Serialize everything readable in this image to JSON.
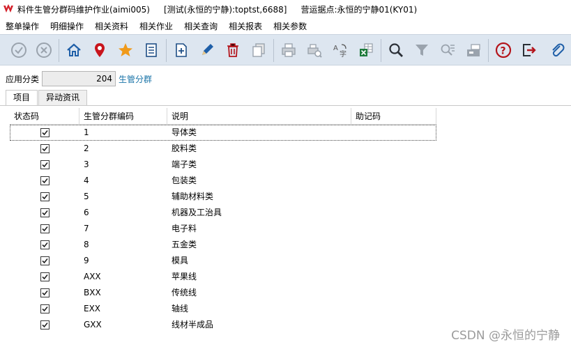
{
  "window": {
    "title": "料件生管分群码维护作业(aimi005)",
    "env": "[测试(永恒的宁静):toptst,6688]",
    "site": "营运据点:永恒的宁静01(KY01)"
  },
  "menu": [
    "整单操作",
    "明细操作",
    "相关资料",
    "相关作业",
    "相关查询",
    "相关报表",
    "相关参数"
  ],
  "toolbar": {
    "buttons": [
      "confirm-icon",
      "cancel-icon",
      "home-icon",
      "location-pin-icon",
      "favorite-star-icon",
      "list-icon",
      "new-document-icon",
      "edit-pencil-icon",
      "delete-trash-icon",
      "copy-icon",
      "print-icon",
      "print-preview-icon",
      "translate-icon",
      "excel-export-icon",
      "search-icon",
      "filter-icon",
      "query-list-icon",
      "attachment-store-icon",
      "help-icon",
      "exit-icon",
      "paperclip-icon"
    ]
  },
  "category": {
    "label": "应用分类",
    "value": "204",
    "desc": "生管分群"
  },
  "tabs": [
    "项目",
    "异动资讯"
  ],
  "grid": {
    "headers": [
      "状态码",
      "生管分群编码",
      "说明",
      "助记码"
    ],
    "rows": [
      {
        "status": true,
        "code": "1",
        "desc": "导体类",
        "mnemonic": ""
      },
      {
        "status": true,
        "code": "2",
        "desc": "胶料类",
        "mnemonic": ""
      },
      {
        "status": true,
        "code": "3",
        "desc": "端子类",
        "mnemonic": ""
      },
      {
        "status": true,
        "code": "4",
        "desc": "包装类",
        "mnemonic": ""
      },
      {
        "status": true,
        "code": "5",
        "desc": "辅助材料类",
        "mnemonic": ""
      },
      {
        "status": true,
        "code": "6",
        "desc": "机器及工治具",
        "mnemonic": ""
      },
      {
        "status": true,
        "code": "7",
        "desc": "电子料",
        "mnemonic": ""
      },
      {
        "status": true,
        "code": "8",
        "desc": "五金类",
        "mnemonic": ""
      },
      {
        "status": true,
        "code": "9",
        "desc": "模具",
        "mnemonic": ""
      },
      {
        "status": true,
        "code": "AXX",
        "desc": "苹果线",
        "mnemonic": ""
      },
      {
        "status": true,
        "code": "BXX",
        "desc": "传统线",
        "mnemonic": ""
      },
      {
        "status": true,
        "code": "EXX",
        "desc": "轴线",
        "mnemonic": ""
      },
      {
        "status": true,
        "code": "GXX",
        "desc": "线材半成品",
        "mnemonic": ""
      }
    ]
  },
  "watermark": "CSDN @永恒的宁静",
  "colors": {
    "toolbar_bg": "#dde6f0",
    "logo_red": "#d4202a",
    "link_blue": "#1a74a8"
  }
}
